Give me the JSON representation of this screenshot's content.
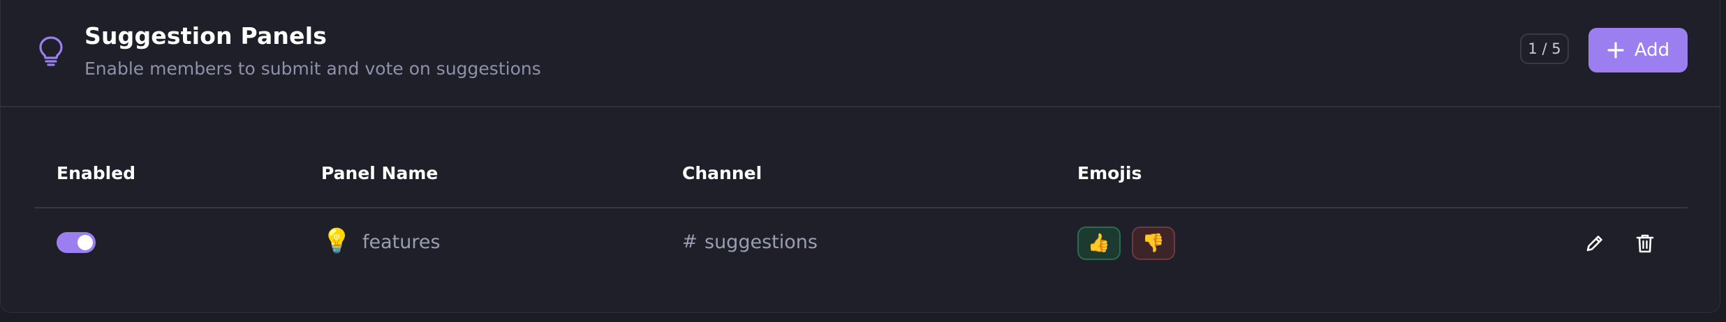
{
  "header": {
    "title": "Suggestion Panels",
    "subtitle": "Enable members to submit and vote on suggestions",
    "count": "1 / 5",
    "add_label": "Add",
    "icon": "lightbulb-icon"
  },
  "table": {
    "columns": [
      "Enabled",
      "Panel Name",
      "Channel",
      "Emojis"
    ],
    "rows": [
      {
        "enabled": true,
        "panel_emoji": "💡",
        "panel_name": "features",
        "channel_prefix": "#",
        "channel": "suggestions",
        "emojis": [
          "👍",
          "👎"
        ],
        "actions": [
          "edit-icon",
          "trash-icon"
        ]
      }
    ]
  },
  "colors": {
    "accent": "#9b7ff0",
    "background": "#1f1f29",
    "upvote_chip": "#1d3a30",
    "downvote_chip": "#3d2429"
  }
}
